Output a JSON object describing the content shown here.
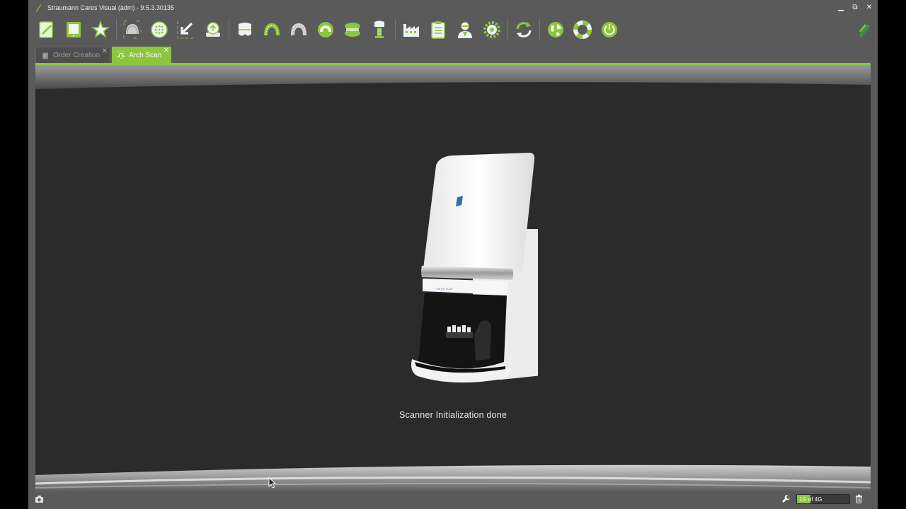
{
  "window": {
    "title": "Straumann Cares Visual (adm) - 9.5.3.30135",
    "controls": {
      "minimize": "▁",
      "restore": "⧉",
      "close": "✕"
    }
  },
  "toolbar": {
    "icons": [
      "edit-document-icon",
      "tablet-icon",
      "favorite-star-icon",
      "scan-impression-icon",
      "scan-plate-icon",
      "import-arrow-icon",
      "load-scan-icon",
      "tooth-crown-icon",
      "arch-green-icon",
      "arch-grey-icon",
      "arch-antagonist-icon",
      "dentures-icon",
      "implant-icon",
      "factory-icon",
      "clipboard-icon",
      "doctor-icon",
      "settings-gear-icon",
      "refresh-icon",
      "globe-icon",
      "support-lifebuoy-icon",
      "power-icon"
    ]
  },
  "tabs": [
    {
      "label": "Order Creation",
      "close": "✕",
      "active": false
    },
    {
      "label": "Arch Scan",
      "close": "✕",
      "active": true
    }
  ],
  "main": {
    "status_message": "Scanner Initialization done"
  },
  "statusbar": {
    "counter_text": "1G of 4G",
    "counter_fraction": 0.25
  },
  "colors": {
    "accent_green": "#8cc63f",
    "content_bg": "#2b2b2b",
    "window_bg": "#5a5a5a"
  }
}
